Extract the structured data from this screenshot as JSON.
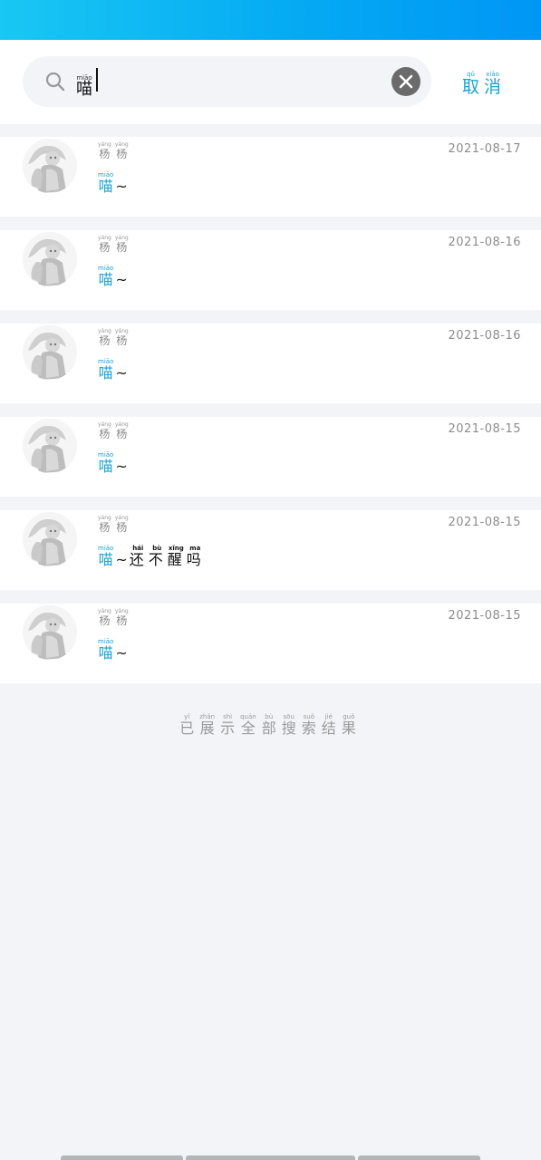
{
  "search": {
    "query": [
      {
        "py": "miāo",
        "hz": "喵"
      }
    ],
    "cancel": [
      {
        "py": "qǔ",
        "hz": "取"
      },
      {
        "py": "xiāo",
        "hz": "消"
      }
    ]
  },
  "results": [
    {
      "name": [
        {
          "py": "yáng",
          "hz": "杨"
        },
        {
          "py": "yáng",
          "hz": "杨"
        }
      ],
      "date": "2021-08-17",
      "match": {
        "py": "miāo",
        "hz": "喵"
      },
      "rest": [
        {
          "py": "",
          "hz": "~"
        }
      ]
    },
    {
      "name": [
        {
          "py": "yáng",
          "hz": "杨"
        },
        {
          "py": "yáng",
          "hz": "杨"
        }
      ],
      "date": "2021-08-16",
      "match": {
        "py": "miāo",
        "hz": "喵"
      },
      "rest": [
        {
          "py": "",
          "hz": "~"
        }
      ]
    },
    {
      "name": [
        {
          "py": "yáng",
          "hz": "杨"
        },
        {
          "py": "yáng",
          "hz": "杨"
        }
      ],
      "date": "2021-08-16",
      "match": {
        "py": "miāo",
        "hz": "喵"
      },
      "rest": [
        {
          "py": "",
          "hz": "~"
        }
      ]
    },
    {
      "name": [
        {
          "py": "yáng",
          "hz": "杨"
        },
        {
          "py": "yáng",
          "hz": "杨"
        }
      ],
      "date": "2021-08-15",
      "match": {
        "py": "miāo",
        "hz": "喵"
      },
      "rest": [
        {
          "py": "",
          "hz": "~"
        }
      ]
    },
    {
      "name": [
        {
          "py": "yáng",
          "hz": "杨"
        },
        {
          "py": "yáng",
          "hz": "杨"
        }
      ],
      "date": "2021-08-15",
      "match": {
        "py": "miāo",
        "hz": "喵"
      },
      "rest": [
        {
          "py": "",
          "hz": "~"
        },
        {
          "py": "hái",
          "hz": "还"
        },
        {
          "py": "bù",
          "hz": "不"
        },
        {
          "py": "xǐng",
          "hz": "醒"
        },
        {
          "py": "ma",
          "hz": "吗"
        }
      ]
    },
    {
      "name": [
        {
          "py": "yáng",
          "hz": "杨"
        },
        {
          "py": "yáng",
          "hz": "杨"
        }
      ],
      "date": "2021-08-15",
      "match": {
        "py": "miāo",
        "hz": "喵"
      },
      "rest": [
        {
          "py": "",
          "hz": "~"
        }
      ]
    }
  ],
  "footer": [
    {
      "py": "yǐ",
      "hz": "已"
    },
    {
      "py": "zhǎn",
      "hz": "展"
    },
    {
      "py": "shì",
      "hz": "示"
    },
    {
      "py": "quán",
      "hz": "全"
    },
    {
      "py": "bù",
      "hz": "部"
    },
    {
      "py": "sōu",
      "hz": "搜"
    },
    {
      "py": "suǒ",
      "hz": "索"
    },
    {
      "py": "jié",
      "hz": "结"
    },
    {
      "py": "guǒ",
      "hz": "果"
    }
  ],
  "icons": {
    "search": "search-icon",
    "clear": "clear-circle-icon",
    "avatar": "avatar-image"
  },
  "colors": {
    "accent": "#1aa2d4",
    "header_start": "#19c7f3",
    "header_end": "#0096f5",
    "background": "#f2f4f8"
  }
}
